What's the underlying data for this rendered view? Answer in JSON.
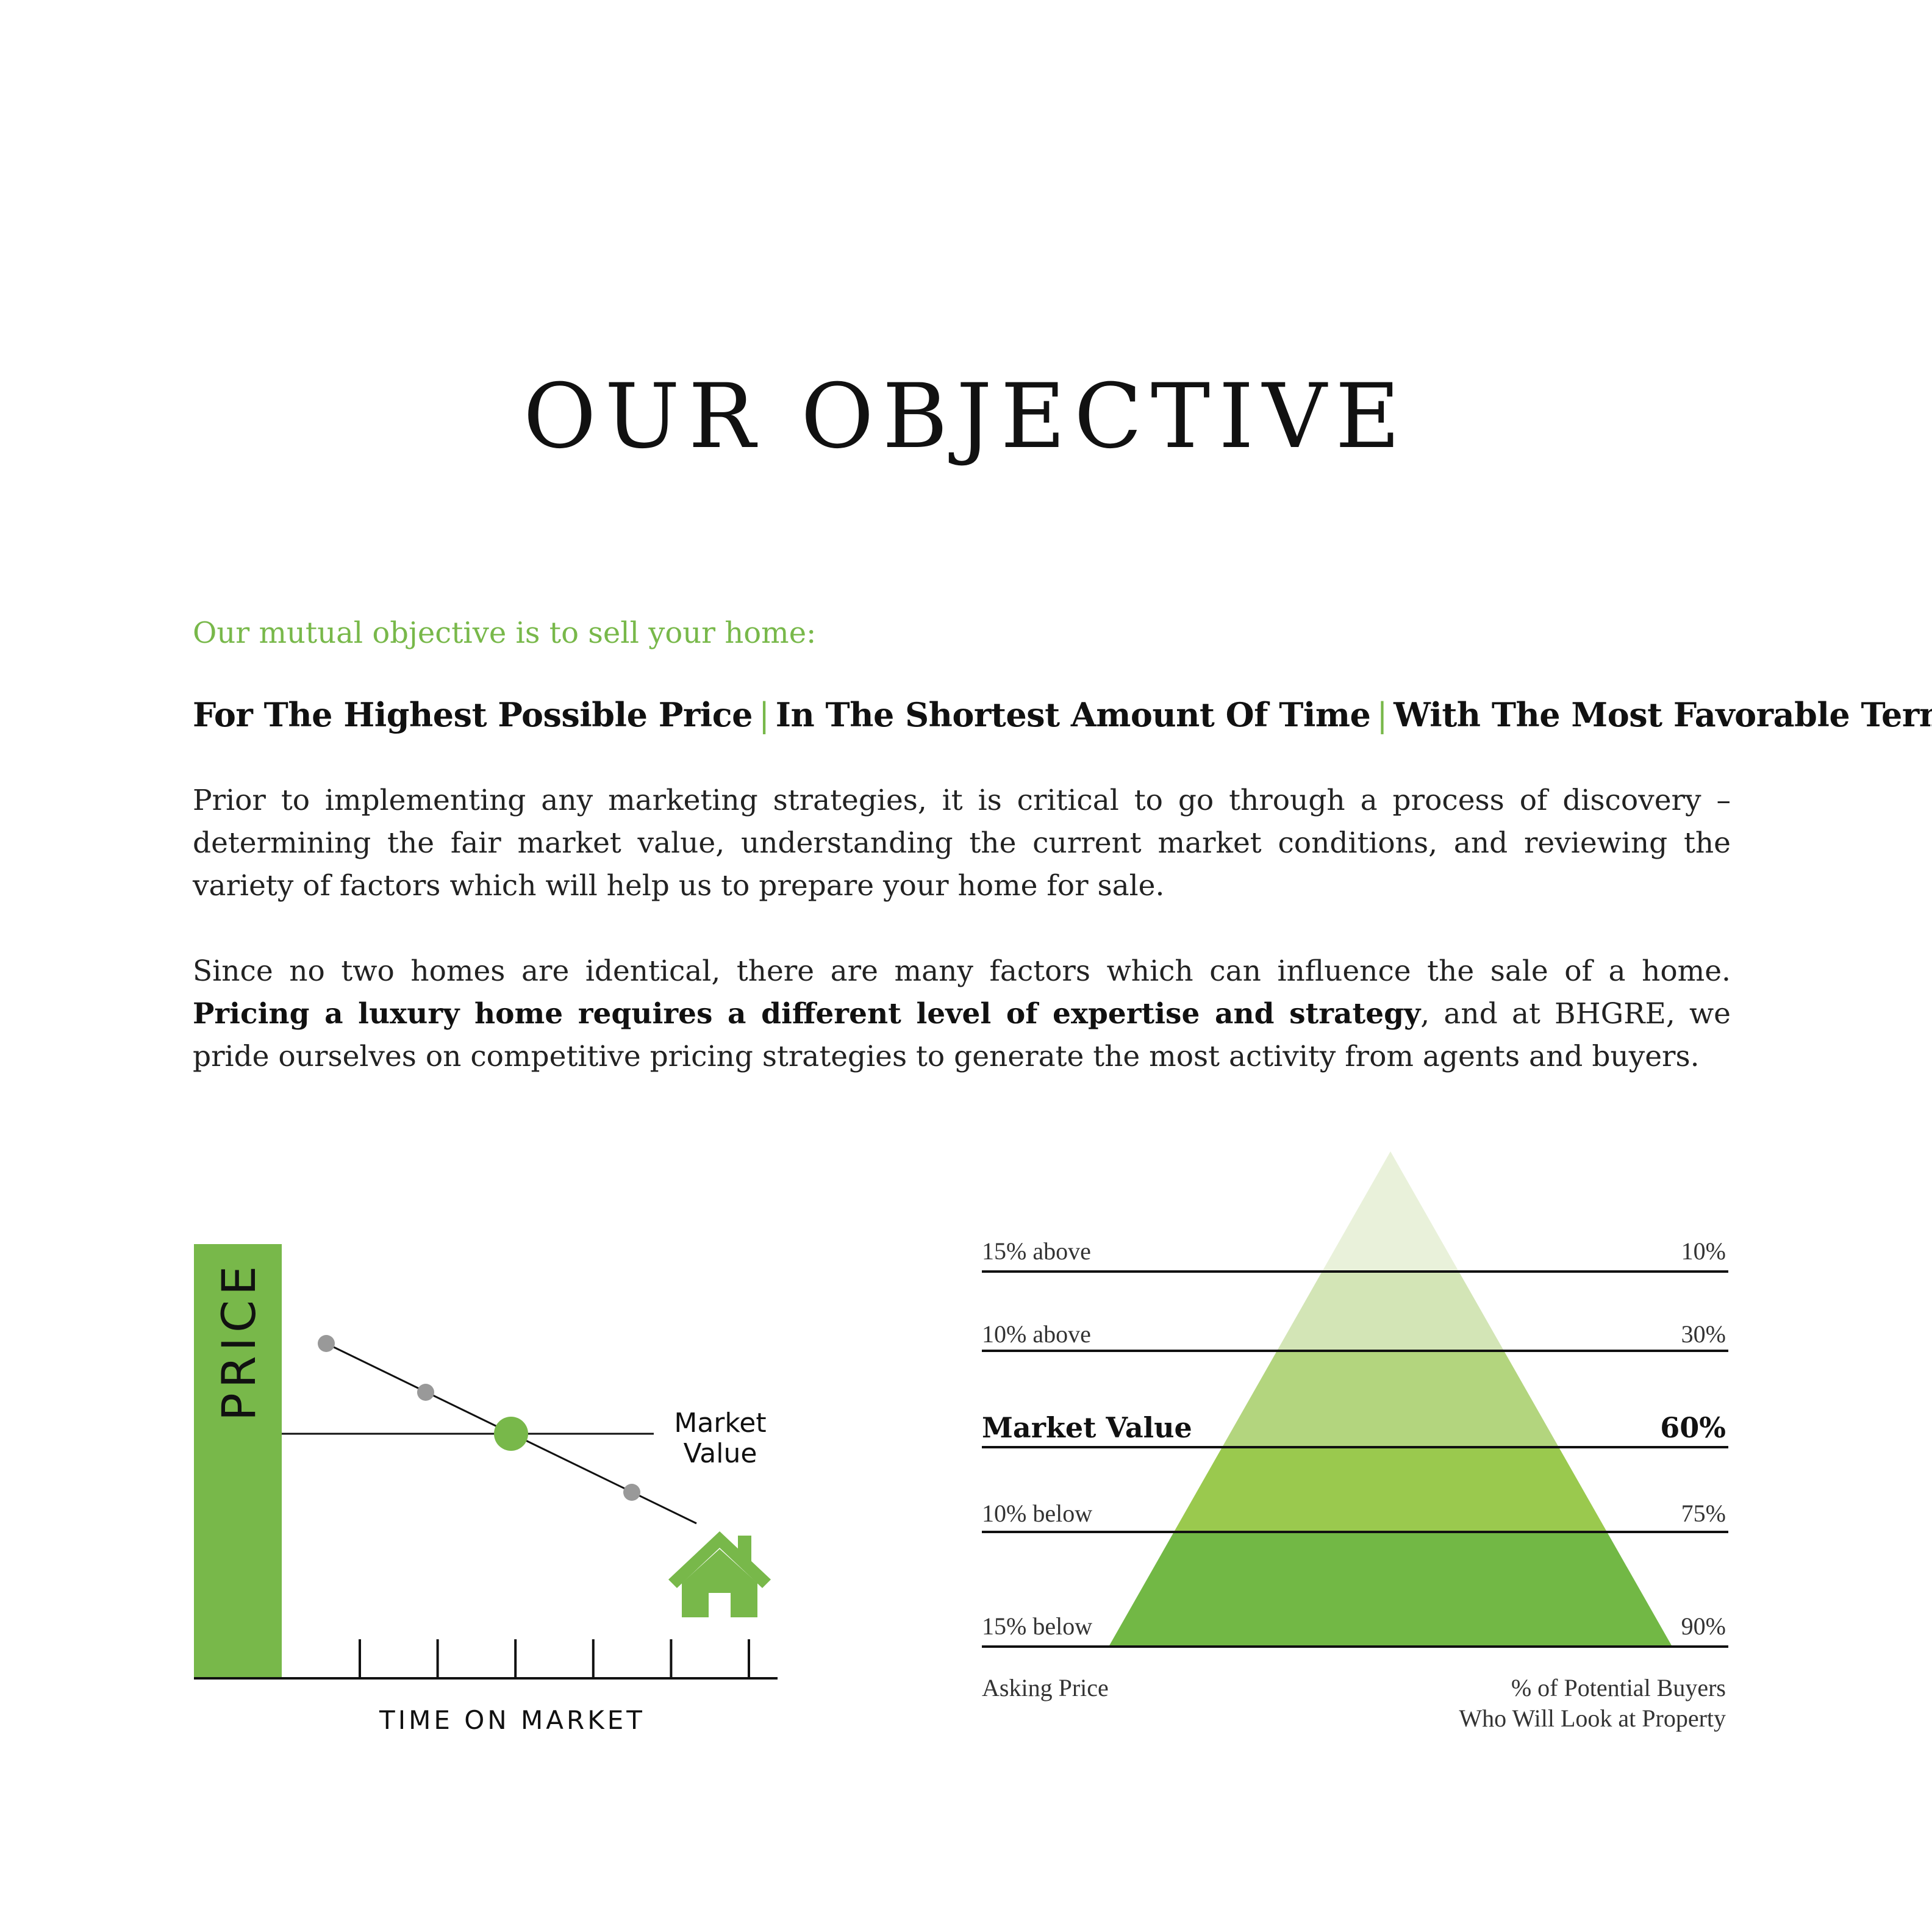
{
  "title": "OUR OBJECTIVE",
  "intro": "Our mutual objective is to sell your home:",
  "goals": [
    "For The Highest Possible Price",
    "In The Shortest Amount Of Time",
    "With The Most Favorable Terms"
  ],
  "separator": "|",
  "paragraph1": "Prior to implementing any marketing strategies, it is critical to go through a process of discovery – determining the fair market value, understanding the current market conditions, and reviewing the variety of factors which will help us to prepare your home for sale.",
  "paragraph2": {
    "before": "Since no two homes are identical, there are many factors which can influence the sale of a home. ",
    "bold": "Pricing a luxury home requires a different level of expertise and strategy",
    "after": ", and at BHGRE, we pride ourselves on competitive pricing strategies to generate the most activity from agents and buyers."
  },
  "colors": {
    "accent": "#78b84a",
    "text": "#111111"
  },
  "chart_data": [
    {
      "type": "line",
      "ylabel": "PRICE",
      "xlabel": "TIME ON MARKET",
      "reference_label": [
        "Market",
        "Value"
      ],
      "tick_count": 6,
      "icon": "house-icon"
    },
    {
      "type": "pyramid",
      "left_axis_label": "Asking Price",
      "right_axis_label": [
        "% of Potential Buyers",
        "Who Will Look at Property"
      ],
      "rows": [
        {
          "asking": "15% above",
          "buyers": "10%",
          "buyers_value": 10,
          "color": "#e9f1da",
          "highlight": false
        },
        {
          "asking": "10% above",
          "buyers": "30%",
          "buyers_value": 30,
          "color": "#d3e5b6",
          "highlight": false
        },
        {
          "asking": "Market Value",
          "buyers": "60%",
          "buyers_value": 60,
          "color": "#b3d57e",
          "highlight": true
        },
        {
          "asking": "10% below",
          "buyers": "75%",
          "buyers_value": 75,
          "color": "#9ac94e",
          "highlight": false
        },
        {
          "asking": "15% below",
          "buyers": "90%",
          "buyers_value": 90,
          "color": "#72b845",
          "highlight": false
        }
      ]
    }
  ]
}
